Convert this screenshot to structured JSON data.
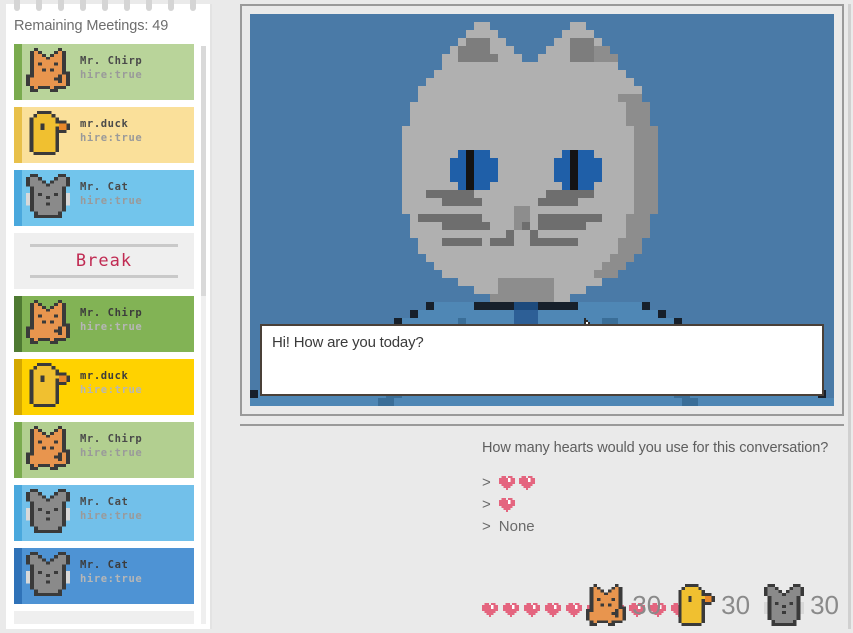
{
  "sidebar": {
    "title": "Remaining Meetings: 49",
    "scrollbar_name": "sidebar-scrollbar",
    "cards": [
      {
        "type": "meeting",
        "name": "Mr. Chirp",
        "hire": "hire:true",
        "animal": "fox",
        "tone": "dim",
        "accent": "#7aab4e",
        "bg": "#b9d49a"
      },
      {
        "type": "meeting",
        "name": "mr.duck",
        "hire": "hire:true",
        "animal": "duck",
        "tone": "dim",
        "accent": "#e8c04a",
        "bg": "#fae09a"
      },
      {
        "type": "meeting",
        "name": "Mr. Cat",
        "hire": "hire:true",
        "animal": "mouse",
        "tone": "dim",
        "accent": "#4aa8dd",
        "bg": "#72c5ec"
      },
      {
        "type": "break",
        "label": "Break"
      },
      {
        "type": "meeting",
        "name": "Mr. Chirp",
        "hire": "hire:true",
        "animal": "fox",
        "tone": "bright",
        "accent": "#4e7a32",
        "bg": "#82b355"
      },
      {
        "type": "meeting",
        "name": "mr.duck",
        "hire": "hire:true",
        "animal": "duck",
        "tone": "bright",
        "accent": "#d4a800",
        "bg": "#ffd200"
      },
      {
        "type": "meeting",
        "name": "Mr. Chirp",
        "hire": "hire:true",
        "animal": "fox",
        "tone": "dim",
        "accent": "#7aab4e",
        "bg": "#b2cf90"
      },
      {
        "type": "meeting",
        "name": "Mr. Cat",
        "hire": "hire:true",
        "animal": "mouse",
        "tone": "dim",
        "accent": "#4aa8dd",
        "bg": "#72c0ea"
      },
      {
        "type": "meeting",
        "name": "Mr. Cat",
        "hire": "hire:true",
        "animal": "mouse",
        "tone": "bright",
        "accent": "#2f72b8",
        "bg": "#4e93d4"
      },
      {
        "type": "break",
        "label": "",
        "partial": true
      }
    ]
  },
  "stage": {
    "background_color": "#4a7aa7",
    "character": "cat-portrait",
    "cursor": "mouse-cursor"
  },
  "dialogue": {
    "text": "Hi! How are you today?"
  },
  "prompt": {
    "question": "How many hearts would you use for this conversation?",
    "options": [
      {
        "caret": ">",
        "hearts": 2,
        "label": ""
      },
      {
        "caret": ">",
        "hearts": 1,
        "label": ""
      },
      {
        "caret": ">",
        "hearts": 0,
        "label": "None"
      }
    ]
  },
  "status": {
    "hearts_remaining": 10,
    "heart_color": "#e4657f",
    "counters": [
      {
        "icon": "fox-icon",
        "value": "30"
      },
      {
        "icon": "duck-icon",
        "value": "30"
      },
      {
        "icon": "mouse-icon",
        "value": "30"
      }
    ]
  }
}
